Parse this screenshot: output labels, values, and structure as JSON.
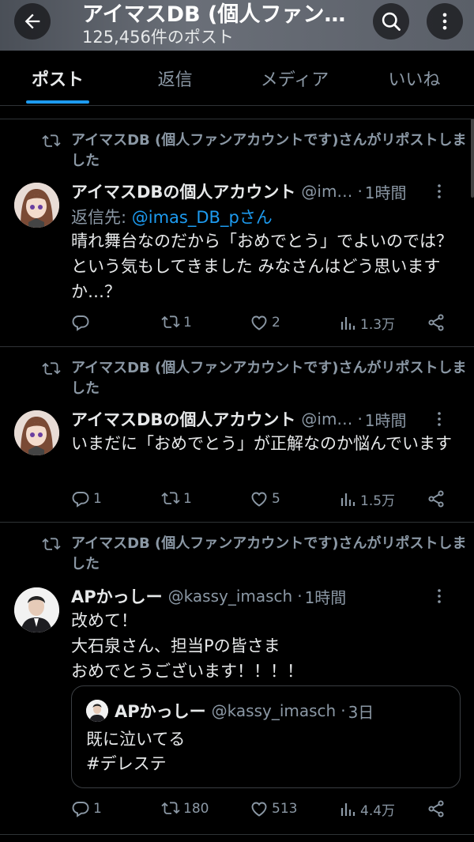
{
  "header": {
    "title": "アイマスDB (個人ファン…",
    "post_count": "125,456件のポスト"
  },
  "tabs": [
    {
      "label": "ポスト",
      "active": true
    },
    {
      "label": "返信",
      "active": false
    },
    {
      "label": "メディア",
      "active": false
    },
    {
      "label": "いいね",
      "active": false
    }
  ],
  "colors": {
    "accent": "#1d9bf0",
    "muted": "#8b98a5",
    "text": "#e7e9ea",
    "background": "#000000"
  },
  "posts": [
    {
      "repost_label": "アイマスDB (個人ファンアカウントです)さんがリポストしました",
      "name": "アイマスDBの個人アカウント",
      "handle": "@im…",
      "dot": "·",
      "time": "1時間",
      "reply_prefix": "返信先:",
      "reply_mention": "@imas_DB_pさん",
      "body": "晴れ舞台なのだから「おめでとう」でよいのでは？という気もしてきました みなさんはどう思いますか…？",
      "replies": "",
      "reposts": "1",
      "likes": "2",
      "views": "1.3万"
    },
    {
      "repost_label": "アイマスDB (個人ファンアカウントです)さんがリポストしました",
      "name": "アイマスDBの個人アカウント",
      "handle": "@im…",
      "dot": "·",
      "time": "1時間",
      "body": "いまだに「おめでとう」が正解なのか悩んでいます",
      "replies": "1",
      "reposts": "1",
      "likes": "5",
      "views": "1.5万"
    },
    {
      "repost_label": "アイマスDB (個人ファンアカウントです)さんがリポストしました",
      "name": "APかっしー",
      "handle": "@kassy_imasch",
      "dot": "·",
      "time": "1時間",
      "body": "改めて！\n大石泉さん、担当Pの皆さま\nおめでとうございます！！！！",
      "quote": {
        "name": "APかっしー",
        "handle": "@kassy_imasch",
        "dot": "·",
        "time": "3日",
        "body": "既に泣いてる\n#デレステ"
      },
      "replies": "1",
      "reposts": "180",
      "likes": "513",
      "views": "4.4万"
    }
  ]
}
